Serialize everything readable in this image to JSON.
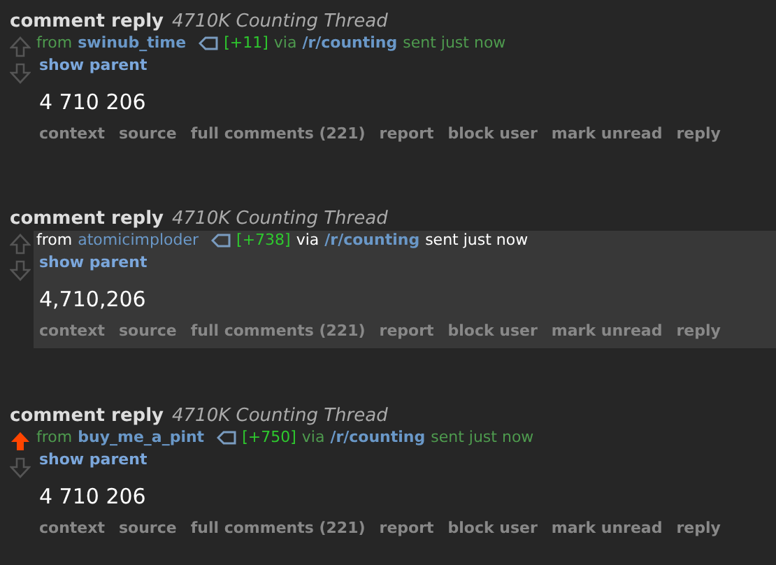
{
  "messages": [
    {
      "subject": "comment reply",
      "thread": "4710K Counting Thread",
      "from_label": "from",
      "author": "swinub_time",
      "karma": "[+11]",
      "via_label": "via",
      "subreddit": "/r/counting",
      "sent": "sent just now",
      "show_parent": "show parent",
      "body": "4 710 206",
      "upvoted": false,
      "unread": false,
      "actions": [
        "context",
        "source",
        "full comments (221)",
        "report",
        "block user",
        "mark unread",
        "reply"
      ]
    },
    {
      "subject": "comment reply",
      "thread": "4710K Counting Thread",
      "from_label": "from",
      "author": "atomicimploder",
      "karma": "[+738]",
      "via_label": "via",
      "subreddit": "/r/counting",
      "sent": "sent just now",
      "show_parent": "show parent",
      "body": "4,710,206",
      "upvoted": false,
      "unread": true,
      "actions": [
        "context",
        "source",
        "full comments (221)",
        "report",
        "block user",
        "mark unread",
        "reply"
      ]
    },
    {
      "subject": "comment reply",
      "thread": "4710K Counting Thread",
      "from_label": "from",
      "author": "buy_me_a_pint",
      "karma": "[+750]",
      "via_label": "via",
      "subreddit": "/r/counting",
      "sent": "sent just now",
      "show_parent": "show parent",
      "body": "4 710 206",
      "upvoted": true,
      "unread": false,
      "actions": [
        "context",
        "source",
        "full comments (221)",
        "report",
        "block user",
        "mark unread",
        "reply"
      ]
    }
  ]
}
